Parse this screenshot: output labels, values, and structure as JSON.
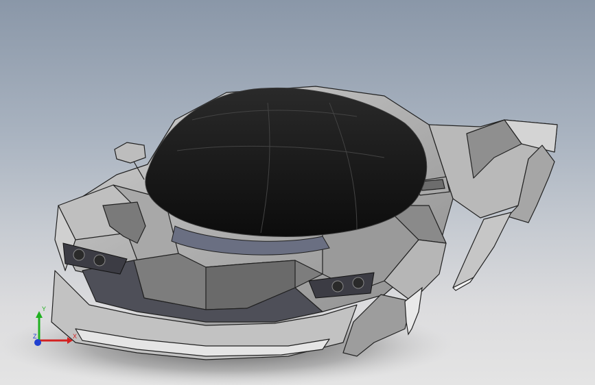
{
  "viewport": {
    "model": "car-body-3d-model",
    "background_top": "#8a97a8",
    "background_bottom": "#e4e4e4"
  },
  "triad": {
    "x_label": "X",
    "y_label": "Y",
    "z_label": "Z",
    "x_color": "#d42020",
    "y_color": "#20b020",
    "z_color": "#2040d0"
  },
  "colors": {
    "canopy": "#141414",
    "body_light": "#c4c4c4",
    "body_mid": "#9a9a9a",
    "body_dark": "#5c5c5c",
    "trim": "#6a6f82"
  }
}
